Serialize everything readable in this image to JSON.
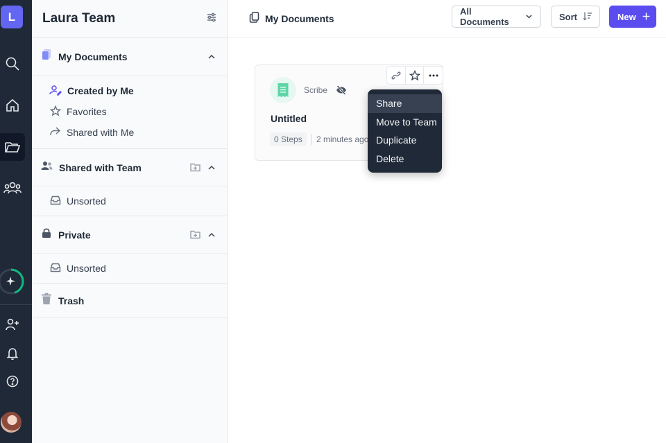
{
  "rail": {
    "logo_letter": "L",
    "icons": [
      "search-icon",
      "home-icon",
      "folder-open-icon",
      "team-icon",
      "sparkle-icon",
      "add-user-icon",
      "bell-icon",
      "help-icon"
    ],
    "progress_fraction": 0.45,
    "accent_color": "#6366f1",
    "progress_color": "#10b981"
  },
  "sidebar": {
    "team_name": "Laura Team",
    "sections": [
      {
        "label": "My Documents",
        "items": [
          "Created by Me",
          "Favorites",
          "Shared with Me"
        ]
      },
      {
        "label": "Shared with Team",
        "items": [
          "Unsorted"
        ]
      },
      {
        "label": "Private",
        "items": [
          "Unsorted"
        ]
      },
      {
        "label": "Trash",
        "items": []
      }
    ]
  },
  "header": {
    "breadcrumb": "My Documents",
    "filter_label": "All Documents",
    "sort_label": "Sort",
    "new_label": "New",
    "brand_color": "#5b4cf0"
  },
  "card": {
    "kind": "Scribe",
    "title": "Untitled",
    "steps": "0 Steps",
    "time": "2 minutes ago"
  },
  "context_menu": {
    "items": [
      "Share",
      "Move to Team",
      "Duplicate",
      "Delete"
    ],
    "highlighted": "Share"
  }
}
